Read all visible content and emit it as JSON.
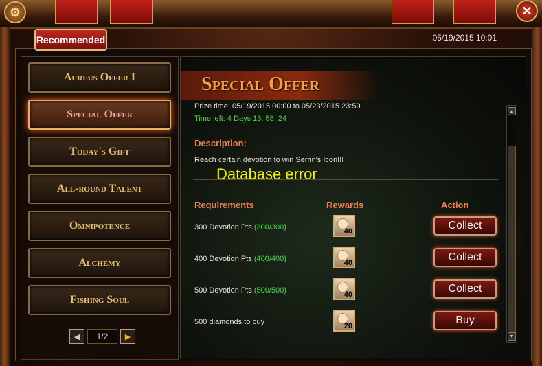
{
  "header": {
    "tab_label": "Recommended",
    "datetime": "05/19/2015 10:01"
  },
  "sidebar": {
    "items": [
      {
        "label": "Aureus Offer I"
      },
      {
        "label": "Special Offer"
      },
      {
        "label": "Today's Gift"
      },
      {
        "label": "All-round Talent"
      },
      {
        "label": "Omnipotence"
      },
      {
        "label": "Alchemy"
      },
      {
        "label": "Fishing Soul"
      }
    ],
    "active_item": "Special Offer",
    "pager": {
      "text": "1/2"
    }
  },
  "content": {
    "title": "Special Offer",
    "prize_time": "Prize time: 05/19/2015 00:00 to 05/23/2015 23:59",
    "time_left": "Time left: 4 Days  13: 58: 24",
    "description_label": "Description:",
    "description_text": "Reach certain devotion to win Serrin's Icon!!!",
    "error_text": "Database error",
    "headers": {
      "requirements": "Requirements",
      "rewards": "Rewards",
      "action": "Action"
    },
    "rows": [
      {
        "req": "300 Devotion Pts.",
        "progress": "(300/300)",
        "reward_count": "40",
        "action": "Collect"
      },
      {
        "req": "400 Devotion Pts.",
        "progress": "(400/400)",
        "reward_count": "40",
        "action": "Collect"
      },
      {
        "req": "500 Devotion Pts.",
        "progress": "(500/500)",
        "reward_count": "40",
        "action": "Collect"
      },
      {
        "req": "500 diamonds to buy",
        "progress": "",
        "reward_count": "20",
        "action": "Buy"
      }
    ]
  },
  "colors": {
    "accent": "#f0a040",
    "progress_green": "#44dd44",
    "header_orange": "#e88050"
  }
}
